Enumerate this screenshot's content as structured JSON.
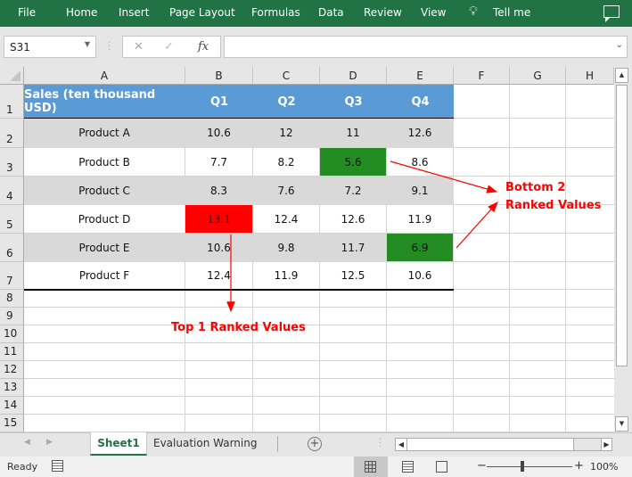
{
  "ribbon": {
    "tabs": [
      "File",
      "Home",
      "Insert",
      "Page Layout",
      "Formulas",
      "Data",
      "Review",
      "View"
    ],
    "tell_me": "Tell me",
    "color": "#217346"
  },
  "formula_bar": {
    "name_box": "S31",
    "cancel_icon": "✕",
    "enter_icon": "✓",
    "fx_label": "fx",
    "formula": ""
  },
  "columns": [
    "A",
    "B",
    "C",
    "D",
    "E",
    "F",
    "G",
    "H"
  ],
  "rows": [
    "1",
    "2",
    "3",
    "4",
    "5",
    "6",
    "7",
    "8",
    "9",
    "10",
    "11",
    "12",
    "13",
    "14",
    "15"
  ],
  "table": {
    "header": [
      "Sales (ten thousand USD)",
      "Q1",
      "Q2",
      "Q3",
      "Q4"
    ],
    "rows": [
      {
        "product": "Product A",
        "values": [
          "10.6",
          "12",
          "11",
          "12.6"
        ]
      },
      {
        "product": "Product B",
        "values": [
          "7.7",
          "8.2",
          "5.6",
          "8.6"
        ]
      },
      {
        "product": "Product C",
        "values": [
          "8.3",
          "7.6",
          "7.2",
          "9.1"
        ]
      },
      {
        "product": "Product D",
        "values": [
          "13.1",
          "12.4",
          "12.6",
          "11.9"
        ]
      },
      {
        "product": "Product E",
        "values": [
          "10.6",
          "9.8",
          "11.7",
          "6.9"
        ]
      },
      {
        "product": "Product F",
        "values": [
          "12.4",
          "11.9",
          "12.5",
          "10.6"
        ]
      }
    ],
    "header_color": "#5b9bd5",
    "band_color": "#d9d9d9",
    "top_color": "#ff0000",
    "bottom_color": "#228b22"
  },
  "annotations": {
    "bottom_line1": "Bottom 2",
    "bottom_line2": "Ranked Values",
    "top": "Top 1 Ranked Values",
    "color": "#ff0000"
  },
  "sheet_tabs": {
    "active": "Sheet1",
    "other": "Evaluation Warning",
    "add": "+"
  },
  "status": {
    "ready": "Ready",
    "zoom_minus": "−",
    "zoom_plus": "+",
    "zoom_level": "100%"
  }
}
